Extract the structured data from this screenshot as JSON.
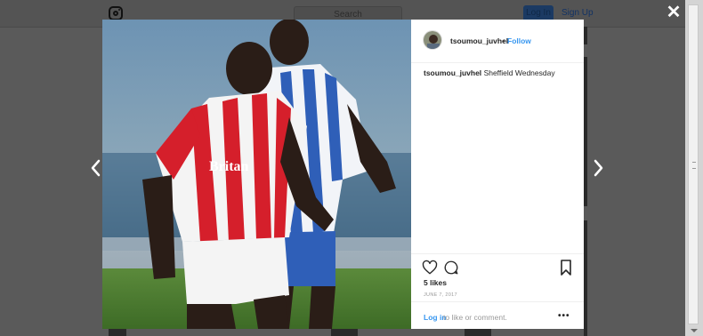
{
  "underlying": {
    "search_placeholder": "Search",
    "login_label": "Log In",
    "signup_label": "Sign Up"
  },
  "modal": {
    "close_glyph": "✕",
    "post": {
      "username": "tsoumou_juvhel",
      "separator": "•",
      "follow_label": "Follow",
      "caption_user": "tsoumou_juvhel",
      "caption_text": "Sheffield Wednesday",
      "likes": "5 likes",
      "date": "JUNE 7, 2017",
      "login_link": "Log in",
      "login_rest": "to like or comment.",
      "more_glyph": "•••"
    },
    "icons": [
      "heart-icon",
      "comment-icon",
      "bookmark-icon",
      "chevron-left-icon",
      "chevron-right-icon",
      "close-icon"
    ],
    "colors": {
      "link": "#3897f0",
      "overlay": "#5a5a5a"
    }
  }
}
